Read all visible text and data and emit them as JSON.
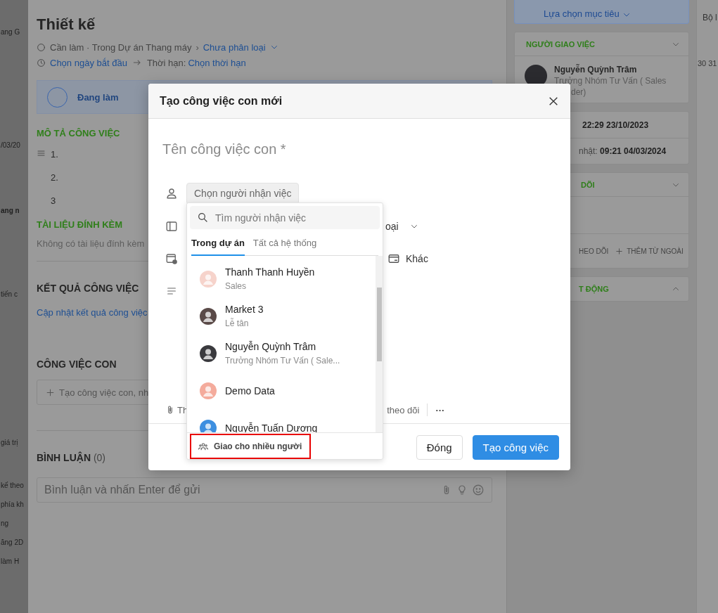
{
  "background_page": {
    "left_fragments": [
      {
        "text": "ang G",
        "bold": false
      },
      {
        "text": "/03/20",
        "bold": false
      },
      {
        "text": "ang n",
        "bold": true
      },
      {
        "text": "tiến c",
        "bold": false
      },
      {
        "text": "giá trị",
        "bold": false
      },
      {
        "text": "kế theo",
        "bold": false
      },
      {
        "text": "phía kh",
        "bold": false
      },
      {
        "text": "ng",
        "bold": false
      },
      {
        "text": "ăng 2D",
        "bold": false
      },
      {
        "text": "làm H",
        "bold": false
      }
    ],
    "right_fragments": [
      "Bộ l",
      "30",
      "31"
    ]
  },
  "task": {
    "title": "Thiết kế",
    "status_text": "Cần làm · Trong Dự án Thang máy",
    "separator": "›",
    "category": "Chưa phân loại",
    "start_date": "Chọn ngày bắt đầu",
    "deadline_label": "Thời hạn:",
    "deadline": "Chọn thời hạn",
    "progress_state": "Đang làm",
    "description": {
      "heading": "MÔ TẢ CÔNG VIỆC",
      "items": [
        "1.",
        "2.",
        "3"
      ]
    },
    "attachments": {
      "heading": "TÀI LIỆU ĐÍNH KÈM",
      "empty": "Không có tài liệu đính kèm"
    },
    "result": {
      "heading": "KẾT QUẢ CÔNG VIỆC",
      "link": "Cập nhật kết quả công việc"
    },
    "subtasks": {
      "heading": "CÔNG VIỆC CON",
      "placeholder": "Tạo công việc con, nh"
    },
    "comments": {
      "heading": "BÌNH LUẬN",
      "count": "(0)",
      "placeholder": "Bình luận và nhấn Enter để gửi"
    }
  },
  "side_panel": {
    "goal_link": "Lựa chọn mục tiêu",
    "assigner": {
      "heading": "NGƯỜI GIAO VIỆC",
      "name": "Nguyễn Quỳnh Trâm",
      "role_line_1": "Trưởng Nhóm Tư Vấn ( Sales",
      "role_line_2": "der)"
    },
    "dates": [
      {
        "value": "22:29 23/10/2023"
      },
      {
        "label": "nhật: ",
        "value": "09:21 04/03/2024"
      }
    ],
    "followers": {
      "heading": "DÕI",
      "actions": [
        {
          "label": "HEO DÕI",
          "plus": false
        },
        {
          "label": "THÊM TỪ NGOÀI",
          "plus": true
        }
      ]
    },
    "activity": {
      "heading": "T ĐỘNG",
      "expanded": true
    }
  },
  "modal": {
    "title": "Tạo công việc con mới",
    "name_placeholder": "Tên công việc con *",
    "assignee_button": "Chọn người nhận việc",
    "category_fragment": "oại",
    "other_label": "Khác",
    "toolbar_fragment": "Th",
    "follow_label": "theo dõi",
    "more": "···",
    "buttons": [
      {
        "label": "Đóng",
        "primary": false
      },
      {
        "label": "Tạo công việc",
        "primary": true
      }
    ]
  },
  "assignee_dropdown": {
    "search_placeholder": "Tìm người nhận việc",
    "tabs": [
      {
        "label": "Trong dự án",
        "selected": true
      },
      {
        "label": "Tất cả hệ thống",
        "selected": false
      }
    ],
    "people": [
      {
        "name": "Thanh Thanh Huyền",
        "role": "Sales",
        "color": "#f6d3cb"
      },
      {
        "name": "Market 3",
        "role": "Lễ tân",
        "color": "#5a4a48"
      },
      {
        "name": "Nguyễn Quỳnh Trâm",
        "role": "Trưởng Nhóm Tư Vấn ( Sale...",
        "color": "#3a3a3e"
      },
      {
        "name": "Demo Data",
        "color": "#f4ab9c"
      },
      {
        "name": "Nguyễn Tuấn Dương",
        "color": "#3d8fe0"
      }
    ],
    "multi_assign": "Giao cho nhiều người"
  }
}
